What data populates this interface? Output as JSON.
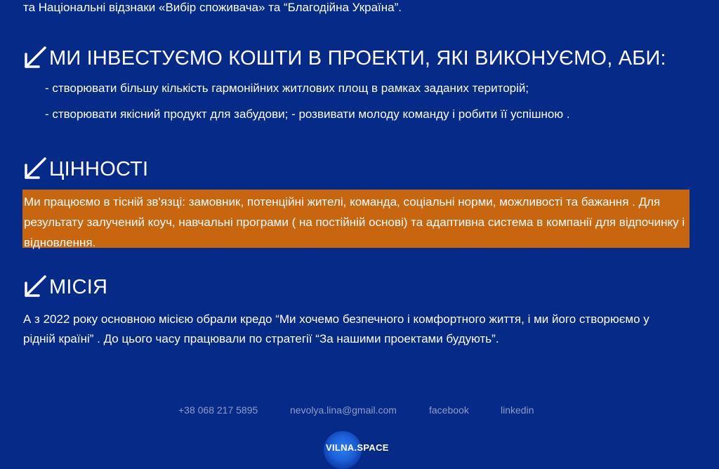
{
  "intro": {
    "text": "та Національні відзнаки «Вибір споживача» та “Благодійна Україна”."
  },
  "invest": {
    "heading": "МИ ІНВЕСТУЄМО КОШТИ В ПРОЕКТИ, ЯКІ ВИКОНУЄМО, АБИ:",
    "icon": "arrow-down-left-icon",
    "items": [
      "- створювати більшу кількість гармонійних житлових площ в рамках заданих територій;",
      "- створювати якісний продукт для забудови; - розвивати молоду команду і робити її успішною ."
    ]
  },
  "values": {
    "heading": "ЦІННОСТІ",
    "icon": "arrow-down-left-icon",
    "text": "Ми працюємо в тісній зв'язці: замовник, потенційні жителі, команда, соціальні норми, можливості та бажання . Для результату залучений коуч, навчальні програми ( на постійній основі) та адаптивна система в компанії для відпочинку і відновлення.",
    "highlight_color": "#c8650f"
  },
  "mission": {
    "heading": "МІСІЯ",
    "icon": "arrow-down-left-icon",
    "text": "А з 2022 року основною місією обрали кредо “Ми хочемо безпечного і комфортного життя, і ми його створюємо у рідній країні” . До цього часу працювали по стратегії “За нашими проектами будують”."
  },
  "footer": {
    "phone": "+38 068 217 5895",
    "email": "nevolya.lina@gmail.com",
    "facebook": "facebook",
    "linkedin": "linkedin",
    "logo_text": "VILNA.SPACE"
  },
  "colors": {
    "background": "#062a87",
    "footer_link": "#8e9dc7"
  }
}
